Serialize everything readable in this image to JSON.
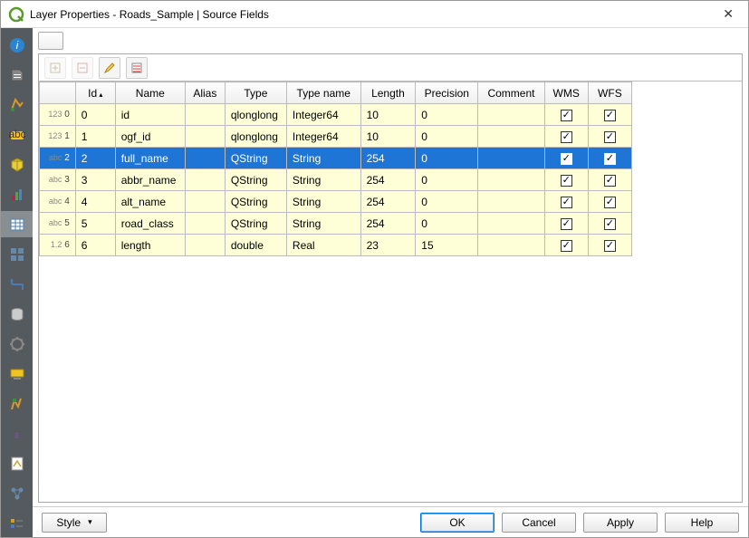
{
  "window": {
    "title": "Layer Properties - Roads_Sample | Source Fields"
  },
  "search": {
    "placeholder": ""
  },
  "table": {
    "headers": {
      "id": "Id",
      "name": "Name",
      "alias": "Alias",
      "type": "Type",
      "typename": "Type name",
      "length": "Length",
      "precision": "Precision",
      "comment": "Comment",
      "wms": "WMS",
      "wfs": "WFS"
    },
    "rows": [
      {
        "ind": "123",
        "id": "0",
        "name": "id",
        "alias": "",
        "type": "qlonglong",
        "typename": "Integer64",
        "length": "10",
        "precision": "0",
        "comment": "",
        "wms": true,
        "wfs": true,
        "selected": false
      },
      {
        "ind": "123",
        "id": "1",
        "name": "ogf_id",
        "alias": "",
        "type": "qlonglong",
        "typename": "Integer64",
        "length": "10",
        "precision": "0",
        "comment": "",
        "wms": true,
        "wfs": true,
        "selected": false
      },
      {
        "ind": "abc",
        "id": "2",
        "name": "full_name",
        "alias": "",
        "type": "QString",
        "typename": "String",
        "length": "254",
        "precision": "0",
        "comment": "",
        "wms": true,
        "wfs": true,
        "selected": true
      },
      {
        "ind": "abc",
        "id": "3",
        "name": "abbr_name",
        "alias": "",
        "type": "QString",
        "typename": "String",
        "length": "254",
        "precision": "0",
        "comment": "",
        "wms": true,
        "wfs": true,
        "selected": false
      },
      {
        "ind": "abc",
        "id": "4",
        "name": "alt_name",
        "alias": "",
        "type": "QString",
        "typename": "String",
        "length": "254",
        "precision": "0",
        "comment": "",
        "wms": true,
        "wfs": true,
        "selected": false
      },
      {
        "ind": "abc",
        "id": "5",
        "name": "road_class",
        "alias": "",
        "type": "QString",
        "typename": "String",
        "length": "254",
        "precision": "0",
        "comment": "",
        "wms": true,
        "wfs": true,
        "selected": false
      },
      {
        "ind": "1.2",
        "id": "6",
        "name": "length",
        "alias": "",
        "type": "double",
        "typename": "Real",
        "length": "23",
        "precision": "15",
        "comment": "",
        "wms": true,
        "wfs": true,
        "selected": false
      }
    ]
  },
  "buttons": {
    "style": "Style",
    "ok": "OK",
    "cancel": "Cancel",
    "apply": "Apply",
    "help": "Help"
  },
  "sidebar_icons": [
    "info-icon",
    "source-icon",
    "symbology-icon",
    "labels-icon",
    "3d-icon",
    "diagrams-icon",
    "fields-icon",
    "attributes-form-icon",
    "joins-icon",
    "auxiliary-storage-icon",
    "actions-icon",
    "display-icon",
    "rendering-icon",
    "variables-icon",
    "metadata-icon",
    "dependencies-icon",
    "legend-icon"
  ],
  "sidebar_selected_index": 6
}
